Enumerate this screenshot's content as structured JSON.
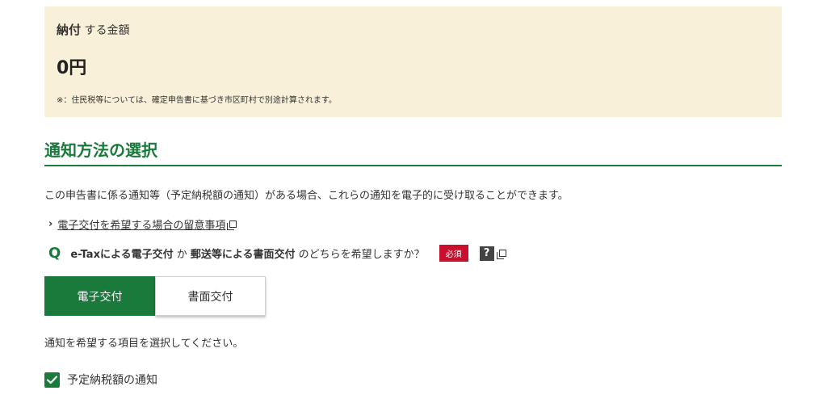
{
  "payment": {
    "label_bold": "納付",
    "label_rest": " する金額",
    "amount": "0円",
    "note": "※：住民税等については、確定申告書に基づき市区町村で別途計算されます。"
  },
  "notification": {
    "title": "通知方法の選択",
    "intro": "この申告書に係る通知等（予定納税額の通知）がある場合、これらの通知を電子的に受け取ることができます。",
    "notes_link": "電子交付を希望する場合の留意事項",
    "question": {
      "mark": "Q",
      "part1_bold": "e-Taxによる電子交付",
      "part2": " か ",
      "part3_bold": "郵送等による書面交付",
      "part4": " のどちらを希望しますか？",
      "required_badge": "必須",
      "help_label": "?"
    },
    "options": [
      {
        "label": "電子交付",
        "selected": true
      },
      {
        "label": "書面交付",
        "selected": false
      }
    ],
    "select_prompt": "通知を希望する項目を選択してください。",
    "checkbox": {
      "label": "予定納税額の通知",
      "checked": true
    }
  },
  "colors": {
    "accent": "#1a7a3c",
    "payment_bg": "#f8f0d8",
    "required_red": "#c8102e"
  }
}
